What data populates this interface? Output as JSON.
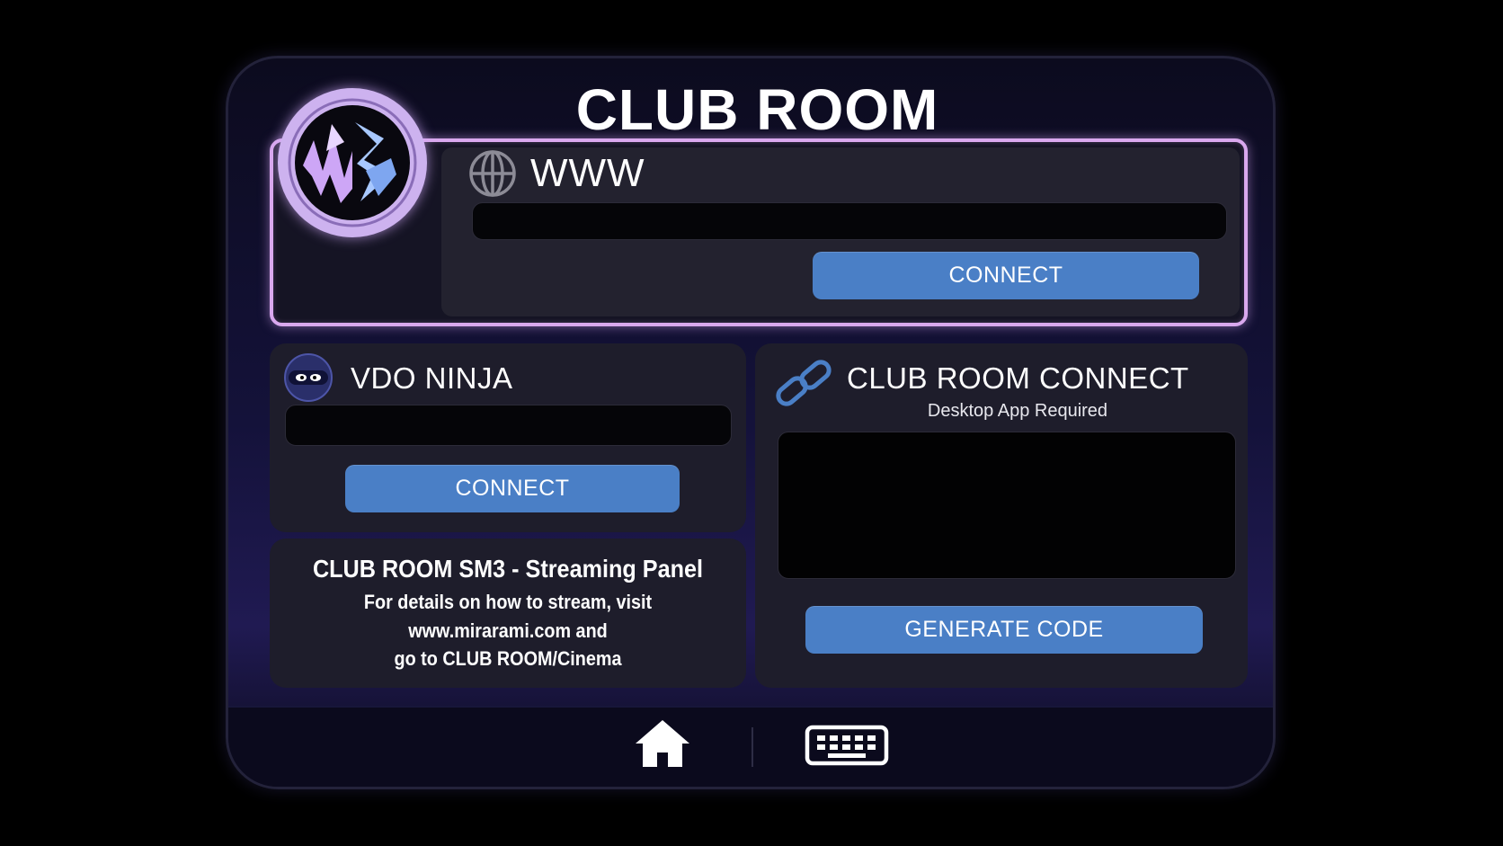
{
  "header": {
    "title": "CLUB ROOM"
  },
  "www": {
    "label": "WWW",
    "url_value": "",
    "connect_label": "CONNECT"
  },
  "vdo_ninja": {
    "label": "VDO NINJA",
    "field_value": "",
    "connect_label": "CONNECT"
  },
  "club_room_connect": {
    "label": "CLUB ROOM CONNECT",
    "subtitle": "Desktop App Required",
    "code_value": "",
    "generate_label": "GENERATE CODE"
  },
  "info": {
    "title": "CLUB ROOM SM3 - Streaming Panel",
    "line1": "For details on how to stream, visit",
    "line2": "www.mirarami.com and",
    "line3": "go to CLUB ROOM/Cinema"
  },
  "bottom_bar": {
    "home_icon": "home-icon",
    "keyboard_icon": "keyboard-icon"
  },
  "colors": {
    "accent_button": "#4a7fc6",
    "highlight_border": "#d9a8ee",
    "card_bg": "#1e1d2b"
  }
}
